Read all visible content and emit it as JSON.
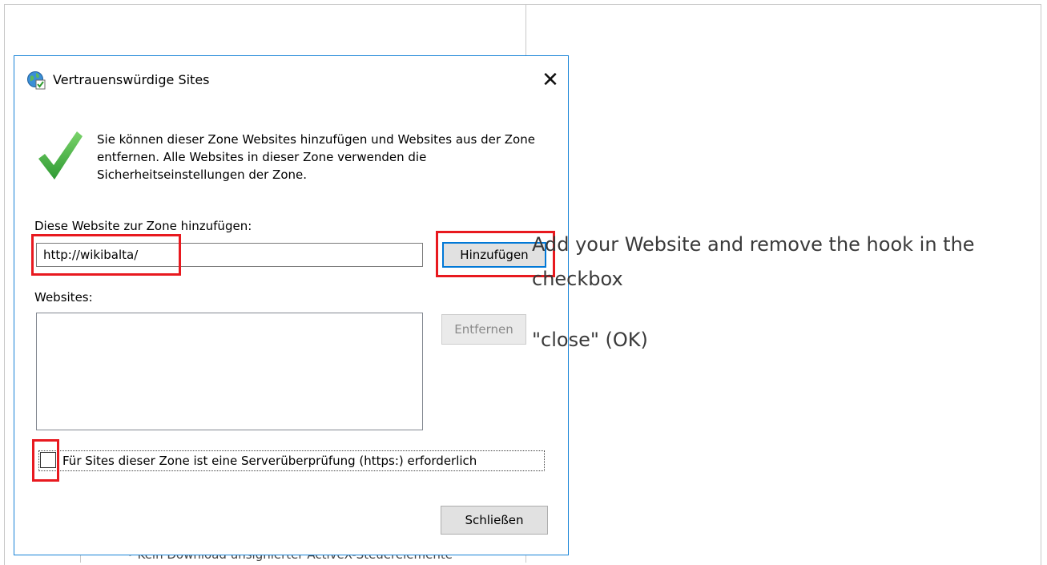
{
  "dialog": {
    "title": "Vertrauenswürdige Sites",
    "close_symbol": "✕",
    "title_icon": "globe-trusted-sites-icon",
    "status_icon": "checkmark-icon",
    "info_text": "Sie können dieser Zone Websites hinzufügen und Websites aus der Zone entfernen. Alle Websites in dieser Zone verwenden die Sicherheitseinstellungen der Zone.",
    "add_label": "Diese Website zur Zone hinzufügen:",
    "url_value": "http://wikibalta/",
    "add_button_label": "Hinzufügen",
    "websites_label": "Websites:",
    "websites": [],
    "remove_button_label": "Entfernen",
    "https_checkbox_label": "Für Sites dieser Zone ist eine Serverüberprüfung (https:) erforderlich",
    "https_checked": false,
    "close_button_label": "Schließen"
  },
  "instructions": {
    "step1": "Add your Website and remove the hook in the checkbox",
    "step2": "\"close\" (OK)"
  },
  "background": {
    "artifact_text": "• Kein Download unsignierter ActiveX-Steuerelemente"
  },
  "colors": {
    "highlight": "#e8191f",
    "focus": "#0078d7",
    "dialog_border": "#1883d7",
    "check_green": "#3aa83a"
  }
}
